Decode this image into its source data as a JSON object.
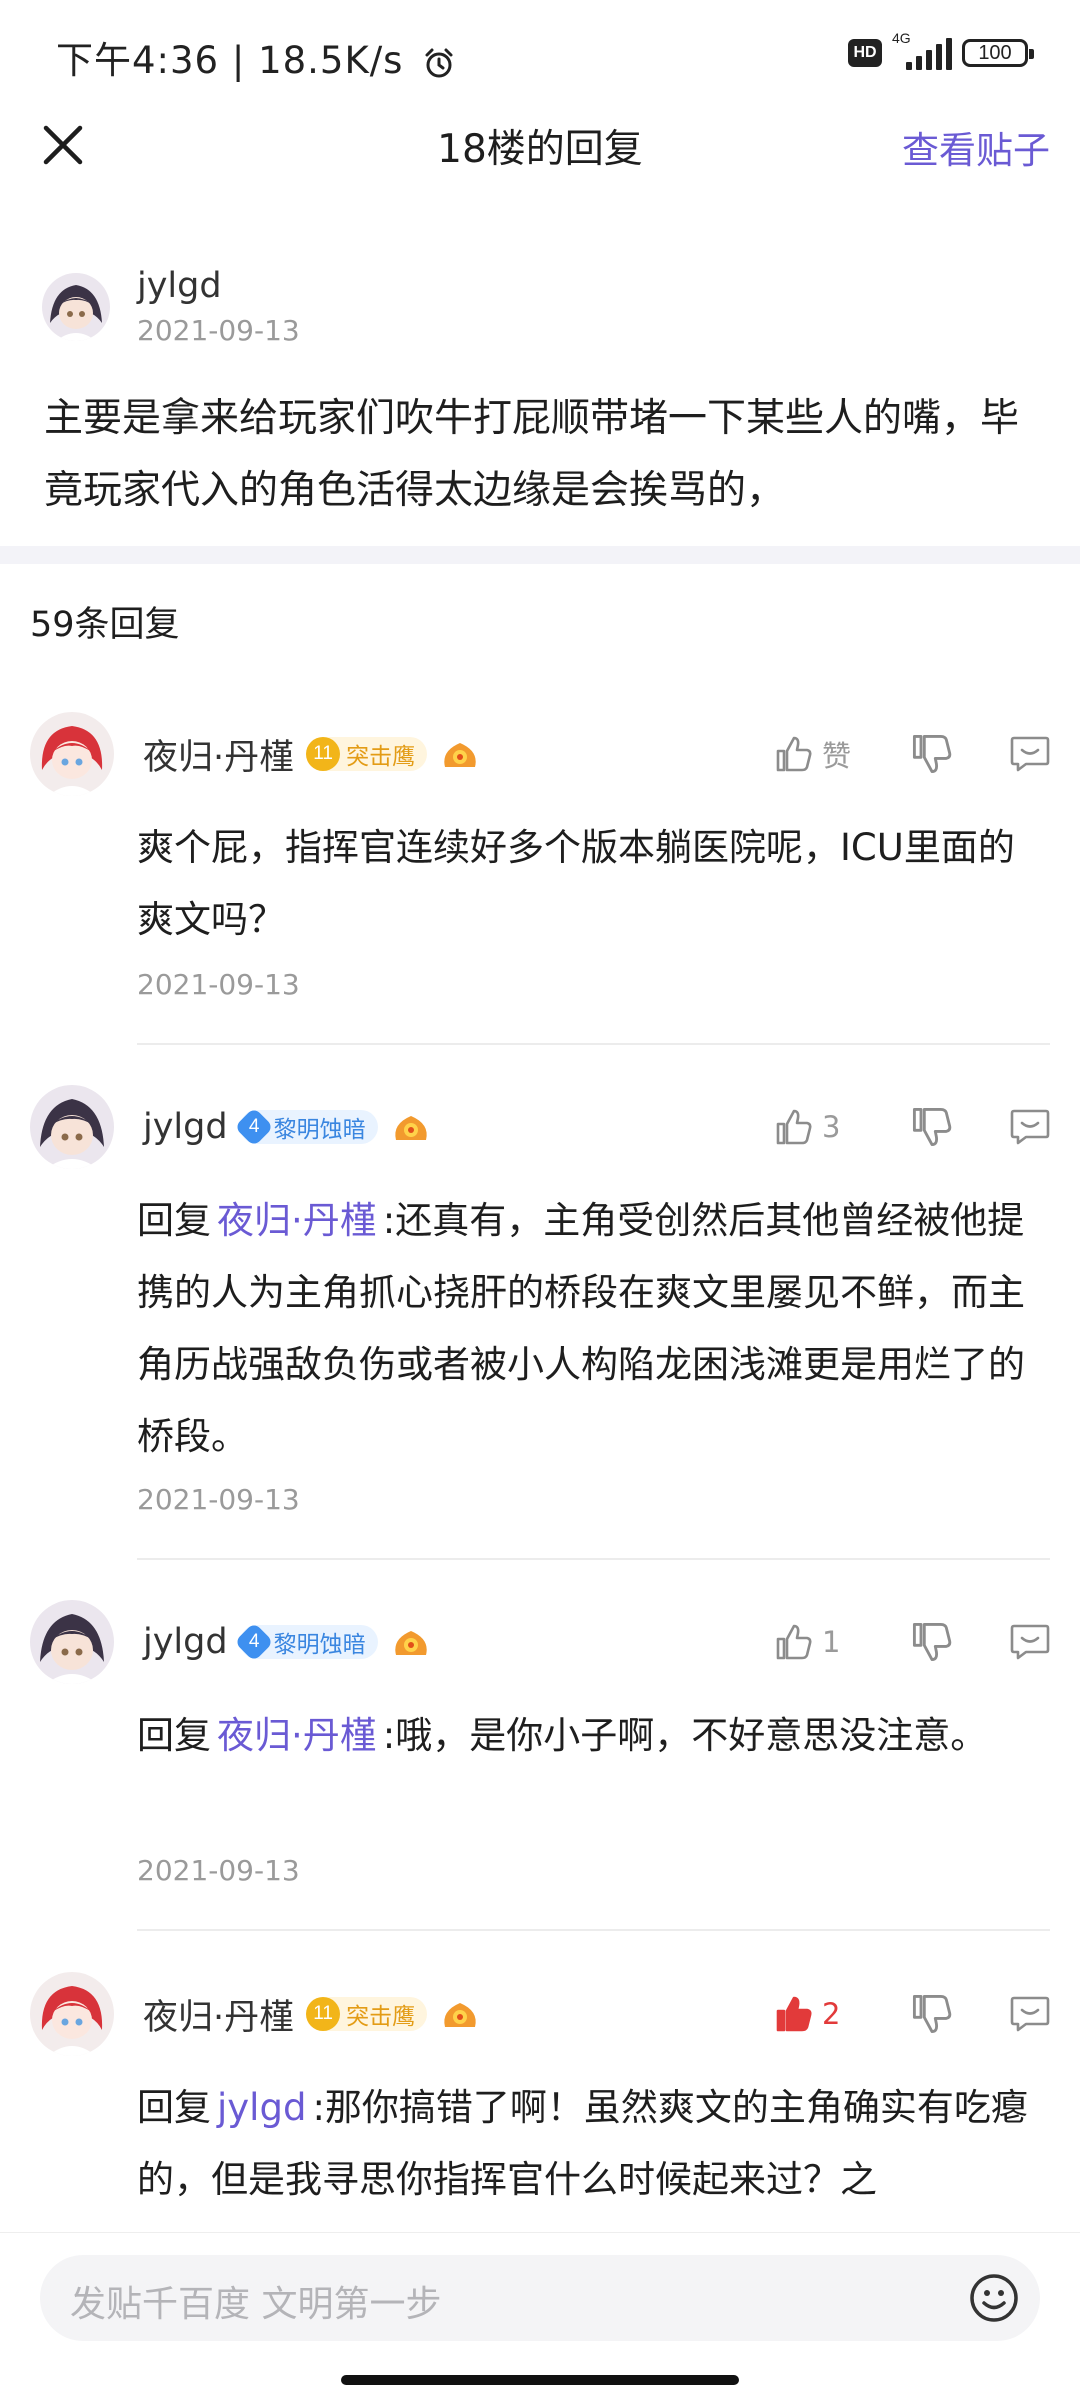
{
  "status_bar": {
    "time": "下午4:36 | 18.5K/s",
    "hd": "HD",
    "network": "4G",
    "battery": "100"
  },
  "header": {
    "title": "18楼的回复",
    "view_post": "查看贴子"
  },
  "original_post": {
    "username": "jylgd",
    "date": "2021-09-13",
    "text": "主要是拿来给玩家们吹牛打屁顺带堵一下某些人的嘴，毕竟玩家代入的角色活得太边缘是会挨骂的，"
  },
  "reply_count": "59条回复",
  "replies": [
    {
      "username": "夜归·丹槿",
      "level": "11",
      "level_title": "突击鹰",
      "like_label": "赞",
      "text": "爽个屁，指挥官连续好多个版本躺医院呢，ICU里面的爽文吗？",
      "date": "2021-09-13"
    },
    {
      "username": "jylgd",
      "level": "4",
      "level_title": "黎明蚀暗",
      "like_label": "3",
      "reply_prefix": "回复",
      "mention": "夜归·丹槿",
      "text": ":还真有，主角受创然后其他曾经被他提携的人为主角抓心挠肝的桥段在爽文里屡见不鲜，而主角历战强敌负伤或者被小人构陷龙困浅滩更是用烂了的桥段。",
      "date": "2021-09-13"
    },
    {
      "username": "jylgd",
      "level": "4",
      "level_title": "黎明蚀暗",
      "like_label": "1",
      "reply_prefix": "回复",
      "mention": "夜归·丹槿",
      "text": ":哦，是你小子啊，不好意思没注意。",
      "date": "2021-09-13"
    },
    {
      "username": "夜归·丹槿",
      "level": "11",
      "level_title": "突击鹰",
      "like_label": "2",
      "reply_prefix": "回复",
      "mention": "jylgd",
      "text": ":那你搞错了啊！虽然爽文的主角确实有吃瘪的，但是我寻思你指挥官什么时候起来过？之"
    }
  ],
  "bottom_bar": {
    "placeholder": "发贴千百度 文明第一步"
  },
  "colors": {
    "accent": "#6a5ad4",
    "like_active": "#e23a3a",
    "muted": "#9a9a9a"
  }
}
